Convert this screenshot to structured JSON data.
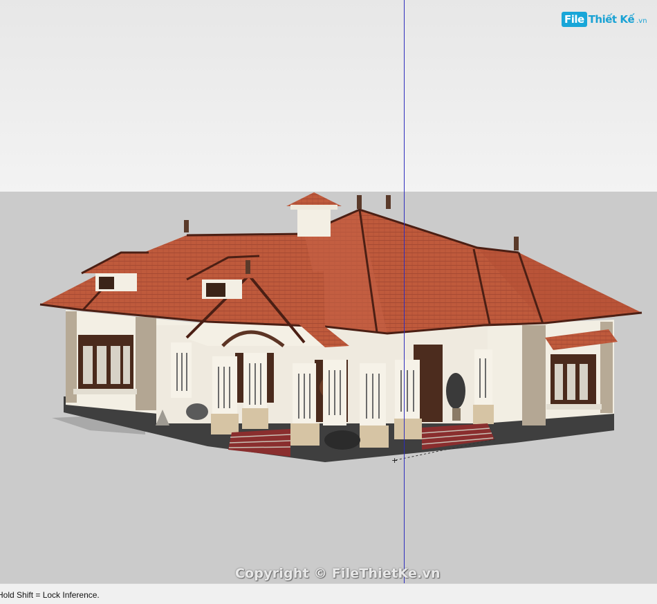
{
  "logo": {
    "file": "File",
    "name": "Thiết Kế",
    "domain": ".vn"
  },
  "watermark": "Copyright © FileThietKe.vn",
  "status_bar": {
    "text": "Hold Shift = Lock Inference."
  },
  "colors": {
    "roof": "#b9563a",
    "wall": "#f3efe4",
    "stone": "#b5a895",
    "axis": "#2d2dbd",
    "sky": "#ececec",
    "ground": "#cbcbcb"
  }
}
